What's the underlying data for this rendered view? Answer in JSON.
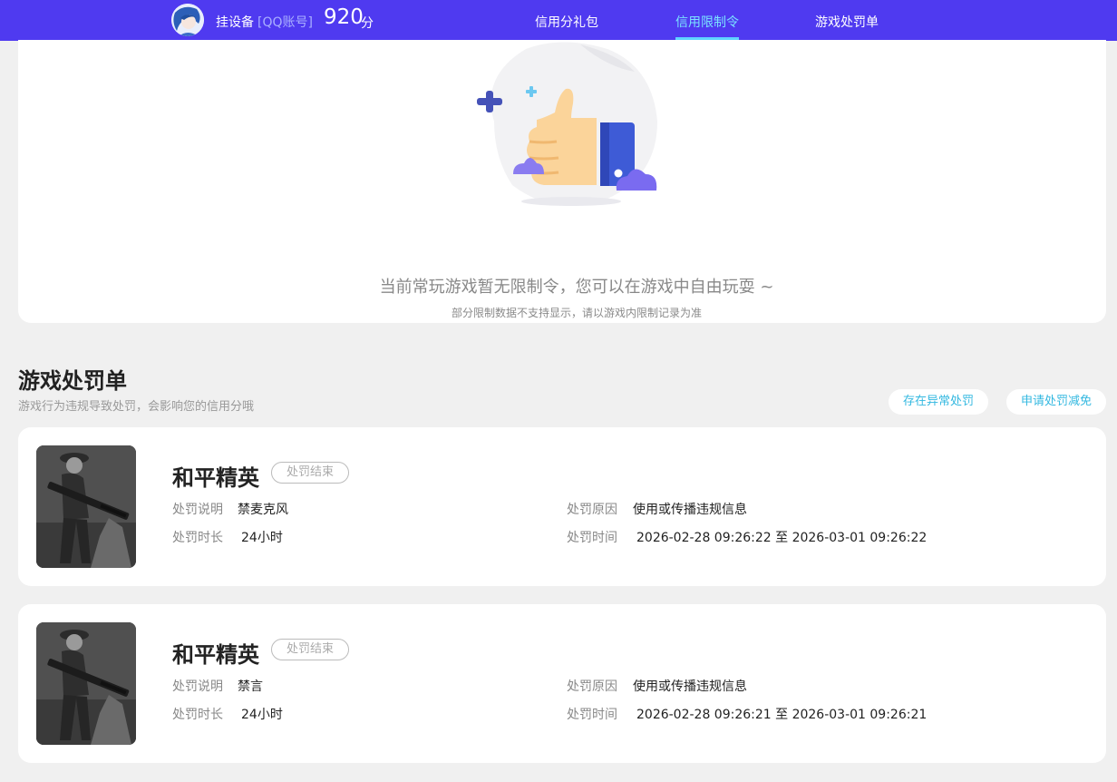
{
  "header": {
    "username": "挂设备",
    "account_tag": "[QQ账号]",
    "score": "920",
    "score_unit": "分",
    "nav": [
      {
        "label": "信用分礼包"
      },
      {
        "label": "信用限制令"
      },
      {
        "label": "游戏处罚单"
      }
    ],
    "accent_color": "#4f3af0",
    "active_color": "#7be3ff"
  },
  "empty_state": {
    "title": "当前常玩游戏暂无限制令，您可以在游戏中自由玩耍 ~",
    "subtitle": "部分限制数据不支持显示，请以游戏内限制记录为准",
    "icon": "thumbs-up-illustration"
  },
  "section": {
    "title": "游戏处罚单",
    "subtitle": "游戏行为违规导致处罚，会影响您的信用分哦",
    "buttons": {
      "abnormal": "存在异常处罚",
      "reduce": "申请处罚减免"
    }
  },
  "records": [
    {
      "game": "和平精英",
      "status": "处罚结束",
      "desc_label": "处罚说明",
      "desc": "禁麦克风",
      "duration_label": "处罚时长",
      "duration": "24小时",
      "reason_label": "处罚原因",
      "reason": "使用或传播违规信息",
      "time_label": "处罚时间",
      "time": "2026-02-28 09:26:22 至 2026-03-01 09:26:22"
    },
    {
      "game": "和平精英",
      "status": "处罚结束",
      "desc_label": "处罚说明",
      "desc": "禁言",
      "duration_label": "处罚时长",
      "duration": "24小时",
      "reason_label": "处罚原因",
      "reason": "使用或传播违规信息",
      "time_label": "处罚时间",
      "time": "2026-02-28 09:26:21 至 2026-03-01 09:26:21"
    }
  ]
}
